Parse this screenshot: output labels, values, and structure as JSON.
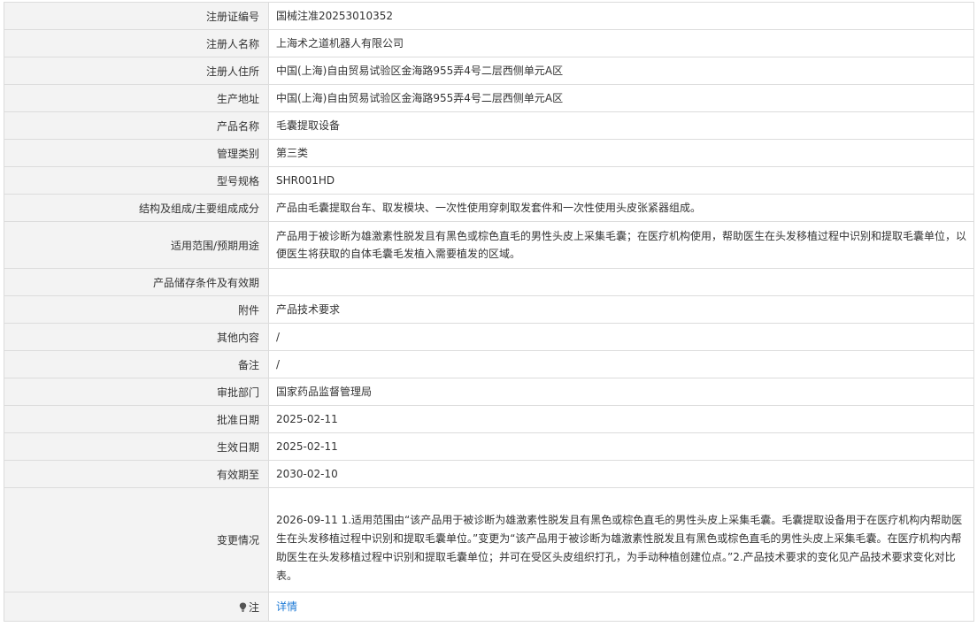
{
  "rows": [
    {
      "label": "注册证编号",
      "value": "国械注准20253010352"
    },
    {
      "label": "注册人名称",
      "value": "上海术之道机器人有限公司"
    },
    {
      "label": "注册人住所",
      "value": "中国(上海)自由贸易试验区金海路955弄4号二层西侧单元A区"
    },
    {
      "label": "生产地址",
      "value": "中国(上海)自由贸易试验区金海路955弄4号二层西侧单元A区"
    },
    {
      "label": "产品名称",
      "value": "毛囊提取设备"
    },
    {
      "label": "管理类别",
      "value": "第三类"
    },
    {
      "label": "型号规格",
      "value": "SHR001HD"
    },
    {
      "label": "结构及组成/主要组成成分",
      "value": "产品由毛囊提取台车、取发模块、一次性使用穿刺取发套件和一次性使用头皮张紧器组成。"
    },
    {
      "label": "适用范围/预期用途",
      "value": "产品用于被诊断为雄激素性脱发且有黑色或棕色直毛的男性头皮上采集毛囊；在医疗机构使用，帮助医生在头发移植过程中识别和提取毛囊单位，以便医生将获取的自体毛囊毛发植入需要植发的区域。"
    },
    {
      "label": "产品储存条件及有效期",
      "value": ""
    },
    {
      "label": "附件",
      "value": "产品技术要求"
    },
    {
      "label": "其他内容",
      "value": "/"
    },
    {
      "label": "备注",
      "value": "/"
    },
    {
      "label": "审批部门",
      "value": "国家药品监督管理局"
    },
    {
      "label": "批准日期",
      "value": "2025-02-11"
    },
    {
      "label": "生效日期",
      "value": "2025-02-11"
    },
    {
      "label": "有效期至",
      "value": "2030-02-10"
    },
    {
      "label": "变更情况",
      "value": "2026-09-11 1.适用范围由“该产品用于被诊断为雄激素性脱发且有黑色或棕色直毛的男性头皮上采集毛囊。毛囊提取设备用于在医疗机构内帮助医生在头发移植过程中识别和提取毛囊单位。”变更为“该产品用于被诊断为雄激素性脱发且有黑色或棕色直毛的男性头皮上采集毛囊。在医疗机构内帮助医生在头发移植过程中识别和提取毛囊单位；并可在受区头皮组织打孔，为手动种植创建位点。”2.产品技术要求的变化见产品技术要求变化对比表。"
    }
  ],
  "note": {
    "label": "注",
    "link_text": "详情",
    "icon": "lightbulb-icon"
  }
}
